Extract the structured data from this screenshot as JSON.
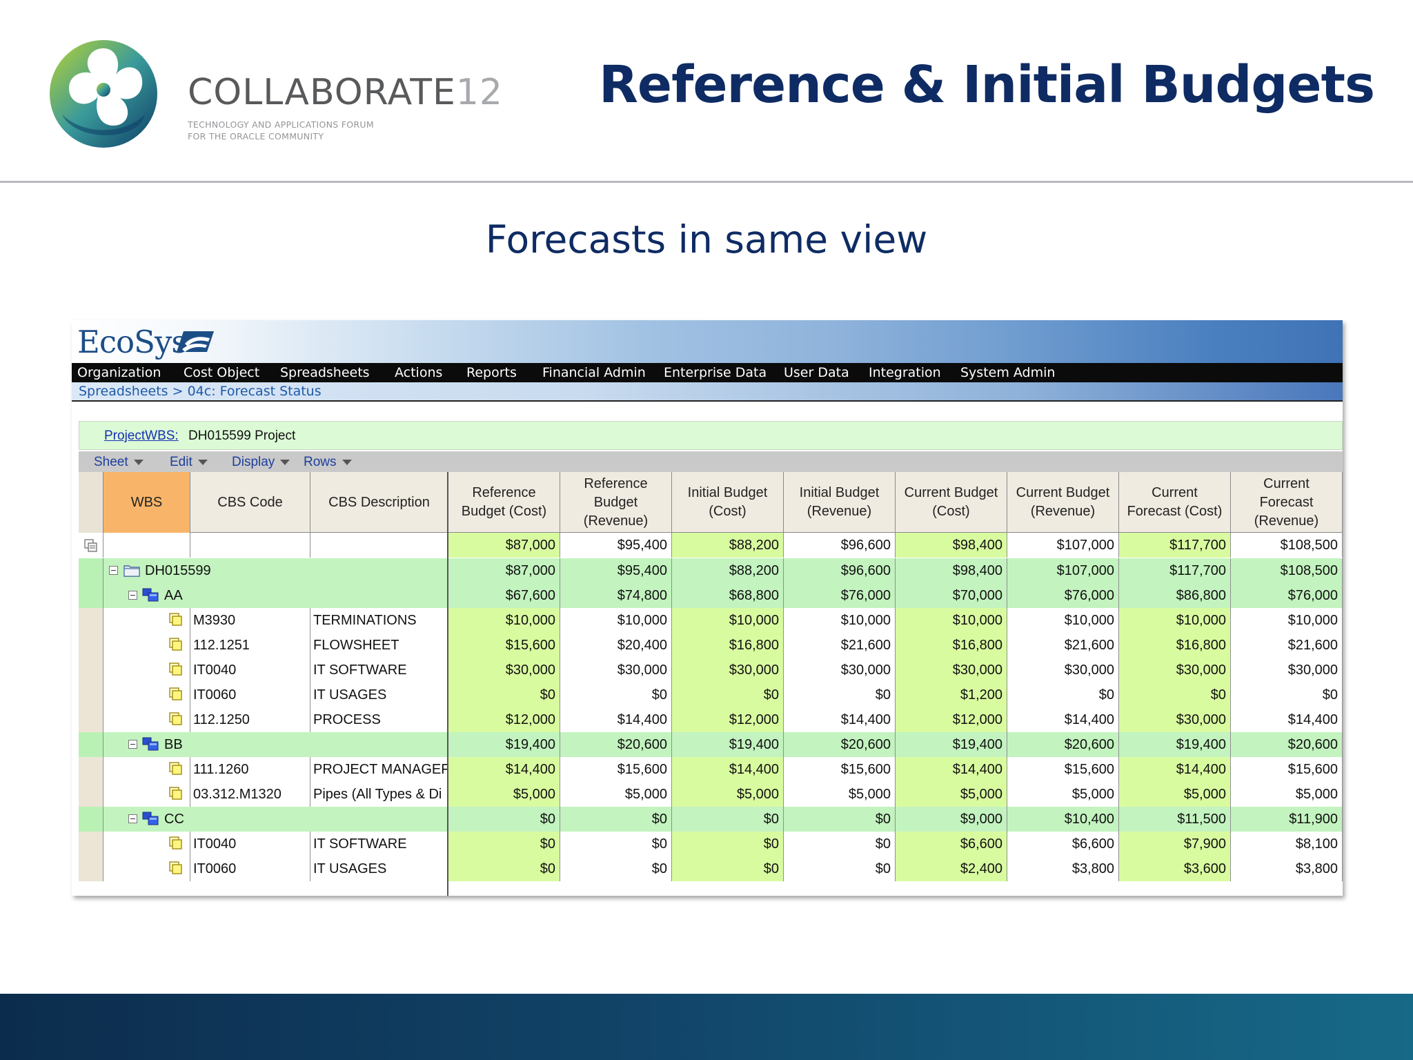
{
  "slide": {
    "brand": {
      "name": "COLLABORATE",
      "year": "12",
      "tagline_1": "TECHNOLOGY AND APPLICATIONS FORUM",
      "tagline_2": "FOR THE ORACLE COMMUNITY"
    },
    "title": "Reference & Initial Budgets",
    "subtitle": "Forecasts in same view"
  },
  "app": {
    "logo": "EcoSys",
    "menu": [
      "Organization",
      "Cost Object",
      "Spreadsheets",
      "Actions",
      "Reports",
      "Financial Admin",
      "Enterprise Data",
      "User Data",
      "Integration",
      "System Admin"
    ],
    "breadcrumb": "Spreadsheets > 04c: Forecast Status",
    "project_label": "ProjectWBS:",
    "project_value": "DH015599 Project",
    "toolbar": [
      "Sheet",
      "Edit",
      "Display",
      "Rows"
    ],
    "columns": [
      "WBS",
      "CBS Code",
      "CBS Description",
      "Reference\nBudget (Cost)",
      "Reference\nBudget\n(Revenue)",
      "Initial Budget\n(Cost)",
      "Initial Budget\n(Revenue)",
      "Current Budget\n(Cost)",
      "Current Budget\n(Revenue)",
      "Current\nForecast (Cost)",
      "Current\nForecast\n(Revenue)"
    ],
    "total_row": [
      "$87,000",
      "$95,400",
      "$88,200",
      "$96,600",
      "$98,400",
      "$107,000",
      "$117,700",
      "$108,500"
    ],
    "rows": [
      {
        "kind": "root",
        "label": "DH015599",
        "values": [
          "$87,000",
          "$95,400",
          "$88,200",
          "$96,600",
          "$98,400",
          "$107,000",
          "$117,700",
          "$108,500"
        ]
      },
      {
        "kind": "group",
        "label": "AA",
        "values": [
          "$67,600",
          "$74,800",
          "$68,800",
          "$76,000",
          "$70,000",
          "$76,000",
          "$86,800",
          "$76,000"
        ]
      },
      {
        "kind": "leaf",
        "code": "M3930",
        "desc": "TERMINATIONS",
        "values": [
          "$10,000",
          "$10,000",
          "$10,000",
          "$10,000",
          "$10,000",
          "$10,000",
          "$10,000",
          "$10,000"
        ]
      },
      {
        "kind": "leaf",
        "code": "112.1251",
        "desc": "FLOWSHEET",
        "values": [
          "$15,600",
          "$20,400",
          "$16,800",
          "$21,600",
          "$16,800",
          "$21,600",
          "$16,800",
          "$21,600"
        ]
      },
      {
        "kind": "leaf",
        "code": "IT0040",
        "desc": "IT SOFTWARE",
        "values": [
          "$30,000",
          "$30,000",
          "$30,000",
          "$30,000",
          "$30,000",
          "$30,000",
          "$30,000",
          "$30,000"
        ]
      },
      {
        "kind": "leaf",
        "code": "IT0060",
        "desc": "IT USAGES",
        "values": [
          "$0",
          "$0",
          "$0",
          "$0",
          "$1,200",
          "$0",
          "$0",
          "$0"
        ]
      },
      {
        "kind": "leaf",
        "code": "112.1250",
        "desc": "PROCESS",
        "values": [
          "$12,000",
          "$14,400",
          "$12,000",
          "$14,400",
          "$12,000",
          "$14,400",
          "$30,000",
          "$14,400"
        ]
      },
      {
        "kind": "group",
        "label": "BB",
        "values": [
          "$19,400",
          "$20,600",
          "$19,400",
          "$20,600",
          "$19,400",
          "$20,600",
          "$19,400",
          "$20,600"
        ]
      },
      {
        "kind": "leaf",
        "code": "111.1260",
        "desc": "PROJECT MANAGEF",
        "values": [
          "$14,400",
          "$15,600",
          "$14,400",
          "$15,600",
          "$14,400",
          "$15,600",
          "$14,400",
          "$15,600"
        ]
      },
      {
        "kind": "leaf",
        "code": "03.312.M1320",
        "desc": "Pipes (All Types & Di",
        "values": [
          "$5,000",
          "$5,000",
          "$5,000",
          "$5,000",
          "$5,000",
          "$5,000",
          "$5,000",
          "$5,000"
        ]
      },
      {
        "kind": "group",
        "label": "CC",
        "values": [
          "$0",
          "$0",
          "$0",
          "$0",
          "$9,000",
          "$10,400",
          "$11,500",
          "$11,900"
        ]
      },
      {
        "kind": "leaf",
        "code": "IT0040",
        "desc": "IT SOFTWARE",
        "values": [
          "$0",
          "$0",
          "$0",
          "$0",
          "$6,600",
          "$6,600",
          "$7,900",
          "$8,100"
        ]
      },
      {
        "kind": "leaf",
        "code": "IT0060",
        "desc": "IT USAGES",
        "values": [
          "$0",
          "$0",
          "$0",
          "$0",
          "$2,400",
          "$3,800",
          "$3,600",
          "$3,800"
        ]
      }
    ]
  },
  "colors": {
    "title": "#0e2b63",
    "group_row": "#c3f3bf",
    "cost_col": "#d9fba0",
    "wbs_header": "#f8b56a",
    "menu_bg": "#0b0b0b"
  },
  "icons": {
    "expander": "minus-box-icon",
    "root": "folder-icon",
    "group": "wbs-node-icon",
    "leaf": "cost-item-icon",
    "freeze": "freeze-panes-icon"
  }
}
